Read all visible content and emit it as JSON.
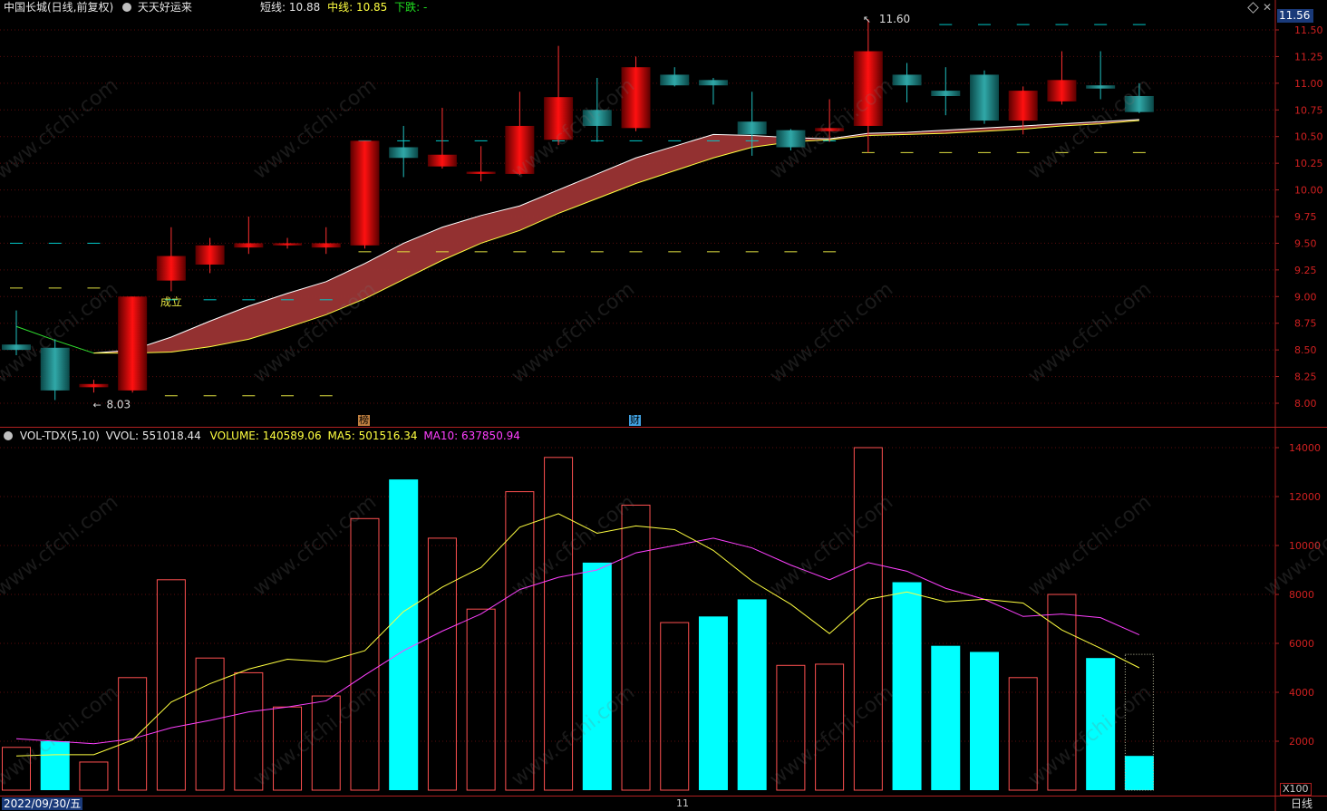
{
  "header": {
    "stock_title": "中国长城(日线,前复权)",
    "indicator_name": "天天好运来",
    "short_label": "短线:",
    "short_value": "10.88",
    "mid_label": "中线:",
    "mid_value": "10.85",
    "trend_label": "下跌:",
    "trend_value": "-"
  },
  "volume_header": {
    "name": "VOL-TDX(5,10)",
    "vvol_label": "VVOL:",
    "vvol_value": "551018.44",
    "volume_label": "VOLUME:",
    "volume_value": "140589.06",
    "ma5_label": "MA5:",
    "ma5_value": "501516.34",
    "ma10_label": "MA10:",
    "ma10_value": "637850.94"
  },
  "footer": {
    "date": "2022/09/30/五",
    "month_tick": "11",
    "period": "日线",
    "vol_unit": "X100"
  },
  "annotations": {
    "high_label": "11.60",
    "low_label": "8.03",
    "signal_label": "成立",
    "marker_bang": "榜",
    "marker_cai": "财"
  },
  "colors": {
    "up": "#ff2020",
    "down": "#00c8c8",
    "vol_down": "#00ffff",
    "ma5": "#ffff40",
    "ma10": "#ff40ff",
    "band_fill": "#9b3434",
    "axis": "#b02020",
    "current_price_bg": "#1a3a7a"
  },
  "chart_data": [
    {
      "type": "candlestick",
      "title": "",
      "current_price": "11.56",
      "y_ticks": [
        "11.50",
        "11.25",
        "11.00",
        "10.75",
        "10.50",
        "10.25",
        "10.00",
        "9.75",
        "9.50",
        "9.25",
        "9.00",
        "8.75",
        "8.50",
        "8.25",
        "8.00"
      ],
      "ylim": [
        7.9,
        11.75
      ],
      "candles": [
        {
          "o": 8.55,
          "h": 8.87,
          "l": 8.45,
          "c": 8.5
        },
        {
          "o": 8.52,
          "h": 8.6,
          "l": 8.03,
          "c": 8.12
        },
        {
          "o": 8.15,
          "h": 8.22,
          "l": 8.1,
          "c": 8.18
        },
        {
          "o": 8.12,
          "h": 9.0,
          "l": 8.1,
          "c": 9.0
        },
        {
          "o": 9.15,
          "h": 9.65,
          "l": 9.05,
          "c": 9.38
        },
        {
          "o": 9.3,
          "h": 9.55,
          "l": 9.22,
          "c": 9.48
        },
        {
          "o": 9.46,
          "h": 9.75,
          "l": 9.4,
          "c": 9.5
        },
        {
          "o": 9.48,
          "h": 9.55,
          "l": 9.45,
          "c": 9.5
        },
        {
          "o": 9.46,
          "h": 9.65,
          "l": 9.4,
          "c": 9.5
        },
        {
          "o": 9.48,
          "h": 10.46,
          "l": 9.45,
          "c": 10.46
        },
        {
          "o": 10.4,
          "h": 10.6,
          "l": 10.12,
          "c": 10.3
        },
        {
          "o": 10.22,
          "h": 10.77,
          "l": 10.2,
          "c": 10.33
        },
        {
          "o": 10.15,
          "h": 10.41,
          "l": 10.08,
          "c": 10.17
        },
        {
          "o": 10.15,
          "h": 10.92,
          "l": 10.14,
          "c": 10.6
        },
        {
          "o": 10.47,
          "h": 11.35,
          "l": 10.42,
          "c": 10.87
        },
        {
          "o": 10.75,
          "h": 11.05,
          "l": 10.45,
          "c": 10.6
        },
        {
          "o": 10.58,
          "h": 11.25,
          "l": 10.55,
          "c": 11.15
        },
        {
          "o": 11.08,
          "h": 11.15,
          "l": 10.97,
          "c": 10.98
        },
        {
          "o": 11.03,
          "h": 11.05,
          "l": 10.8,
          "c": 10.98
        },
        {
          "o": 10.64,
          "h": 10.92,
          "l": 10.32,
          "c": 10.52
        },
        {
          "o": 10.56,
          "h": 10.57,
          "l": 10.37,
          "c": 10.4
        },
        {
          "o": 10.55,
          "h": 10.85,
          "l": 10.45,
          "c": 10.58
        },
        {
          "o": 10.6,
          "h": 11.6,
          "l": 10.35,
          "c": 11.3
        },
        {
          "o": 11.08,
          "h": 11.19,
          "l": 10.82,
          "c": 10.98
        },
        {
          "o": 10.93,
          "h": 11.15,
          "l": 10.7,
          "c": 10.88
        },
        {
          "o": 11.08,
          "h": 11.12,
          "l": 10.62,
          "c": 10.65
        },
        {
          "o": 10.65,
          "h": 10.97,
          "l": 10.52,
          "c": 10.93
        },
        {
          "o": 10.83,
          "h": 11.3,
          "l": 10.8,
          "c": 11.03
        },
        {
          "o": 10.98,
          "h": 11.3,
          "l": 10.85,
          "c": 10.95
        },
        {
          "o": 10.88,
          "h": 11.0,
          "l": 10.72,
          "c": 10.73
        }
      ],
      "short_line": [
        8.72,
        8.59,
        8.47,
        8.5,
        8.62,
        8.77,
        8.91,
        9.03,
        9.14,
        9.31,
        9.5,
        9.65,
        9.76,
        9.85,
        10.0,
        10.15,
        10.3,
        10.41,
        10.52,
        10.51,
        10.49,
        10.48,
        10.53,
        10.54,
        10.56,
        10.58,
        10.6,
        10.62,
        10.64,
        10.66
      ],
      "mid_line": [
        null,
        null,
        8.47,
        8.47,
        8.48,
        8.53,
        8.6,
        8.71,
        8.83,
        8.98,
        9.16,
        9.34,
        9.5,
        9.62,
        9.78,
        9.92,
        10.06,
        10.18,
        10.3,
        10.4,
        10.45,
        10.47,
        10.51,
        10.52,
        10.53,
        10.55,
        10.57,
        10.6,
        10.62,
        10.65
      ],
      "dashes": [
        {
          "start": 0,
          "end": 2,
          "price": 9.5,
          "color": "#00c8c8"
        },
        {
          "start": 0,
          "end": 2,
          "price": 9.08,
          "color": "#e0e040"
        },
        {
          "start": 4,
          "end": 8,
          "price": 8.97,
          "color": "#00c8c8"
        },
        {
          "start": 4,
          "end": 8,
          "price": 8.07,
          "color": "#e0e040"
        },
        {
          "start": 9,
          "end": 21,
          "price": 10.46,
          "color": "#00c8c8"
        },
        {
          "start": 9,
          "end": 21,
          "price": 9.42,
          "color": "#e0e040"
        },
        {
          "start": 24,
          "end": 29,
          "price": 11.55,
          "color": "#00c8c8"
        },
        {
          "start": 22,
          "end": 29,
          "price": 10.35,
          "color": "#e0e040"
        }
      ]
    },
    {
      "type": "bar",
      "title": "",
      "y_ticks": [
        "14000",
        "12000",
        "10000",
        "8000",
        "6000",
        "4000",
        "2000"
      ],
      "ylim": [
        0,
        14800
      ],
      "volumes": [
        1750,
        2000,
        1150,
        4600,
        8600,
        5400,
        4800,
        3400,
        3850,
        11100,
        12700,
        10300,
        7400,
        12200,
        13600,
        9300,
        11650,
        6850,
        7100,
        7800,
        5100,
        5150,
        14000,
        8500,
        5900,
        5650,
        4600,
        8000,
        5400,
        1400
      ],
      "up": [
        true,
        false,
        true,
        true,
        true,
        true,
        true,
        true,
        true,
        true,
        false,
        true,
        true,
        true,
        true,
        false,
        true,
        true,
        false,
        false,
        true,
        true,
        true,
        false,
        false,
        false,
        true,
        true,
        false,
        false
      ],
      "ma5": [
        1400,
        1450,
        1450,
        2050,
        3600,
        4350,
        4950,
        5350,
        5250,
        5700,
        7300,
        8300,
        9100,
        10750,
        11300,
        10500,
        10800,
        10650,
        9800,
        8550,
        7600,
        6400,
        7800,
        8100,
        7700,
        7800,
        7650,
        6550,
        5800,
        5000
      ],
      "ma10": [
        2100,
        2000,
        1900,
        2100,
        2550,
        2850,
        3200,
        3400,
        3650,
        4700,
        5700,
        6500,
        7200,
        8200,
        8700,
        9000,
        9700,
        10000,
        10300,
        9900,
        9200,
        8600,
        9300,
        8950,
        8250,
        7800,
        7100,
        7200,
        7050,
        6350
      ],
      "projection_value": 5550
    }
  ]
}
